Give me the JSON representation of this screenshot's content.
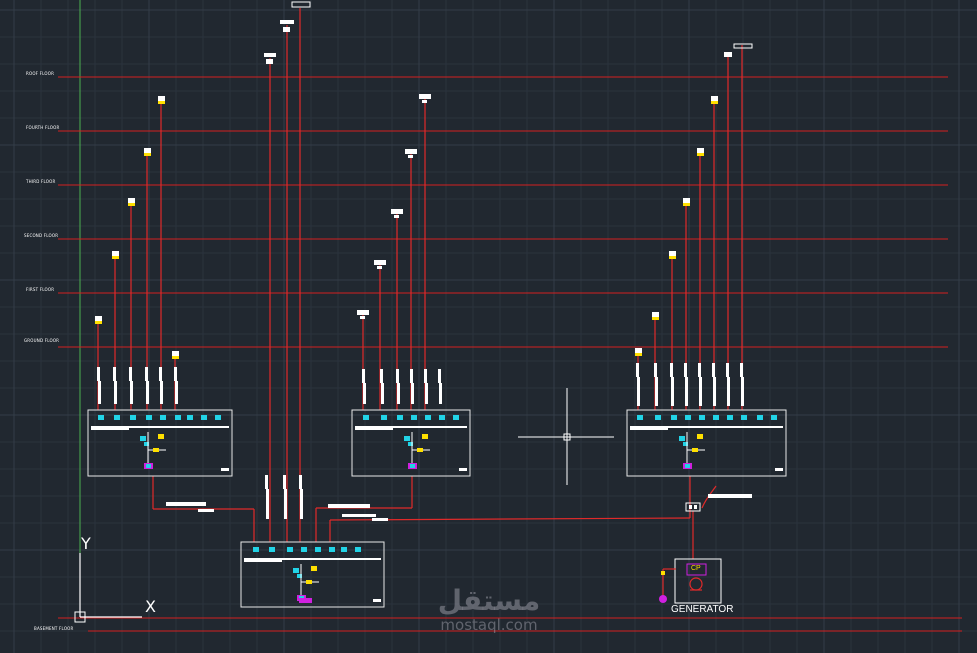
{
  "floors": [
    {
      "key": "roof",
      "label": "ROOF FLOOR"
    },
    {
      "key": "fourth",
      "label": "FOURTH FLOOR"
    },
    {
      "key": "third",
      "label": "THIRD FLOOR"
    },
    {
      "key": "second",
      "label": "SECOND FLOOR"
    },
    {
      "key": "first",
      "label": "FIRST FLOOR"
    },
    {
      "key": "ground",
      "label": "GROUND FLOOR"
    },
    {
      "key": "basement",
      "label": "BASEMENT FLOOR"
    }
  ],
  "generator": {
    "label": "GENERATOR",
    "panel_label": "CP"
  },
  "axis": {
    "y": "Y",
    "x": "X"
  },
  "watermark": {
    "arabic": "مستقل",
    "latin": "mostaql.com"
  },
  "colors": {
    "background": "#212830",
    "grid": "#2b333d",
    "grid_major": "#343d48",
    "floor_line": "#d42020",
    "riser": "#e02a2a",
    "panel_outline": "#e8e8e8",
    "breaker": "#22d3e6",
    "meter": "#ffe000",
    "busbar": "#ffffff",
    "axis_green": "#4caf50",
    "magenta": "#d020e0"
  }
}
